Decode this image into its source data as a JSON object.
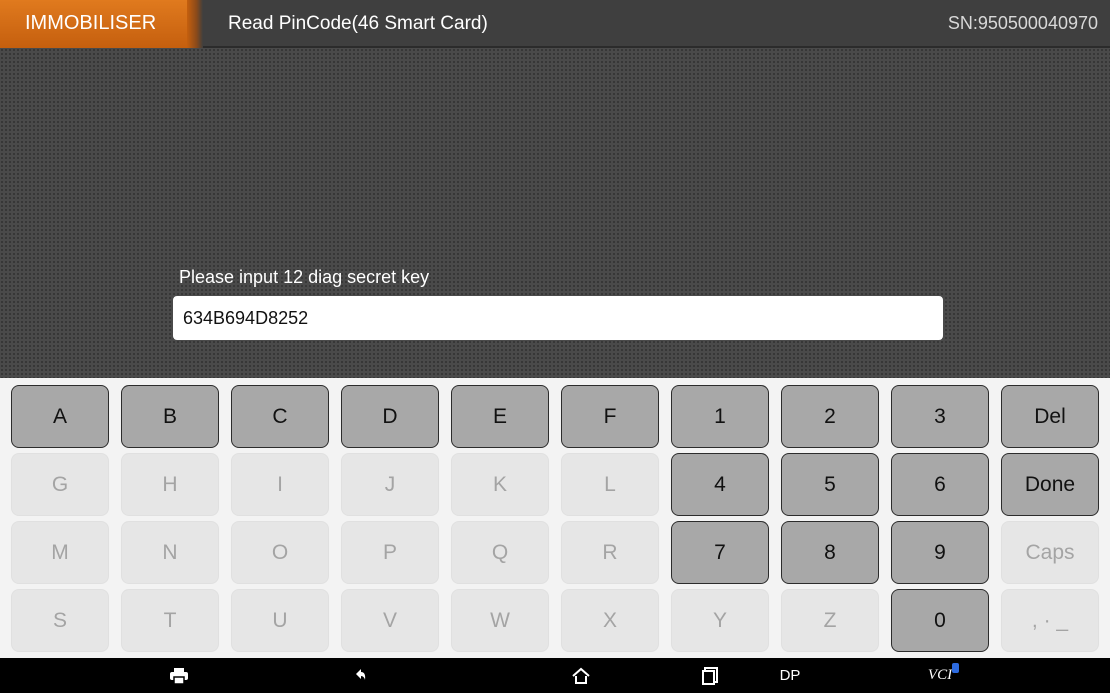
{
  "header": {
    "module": "IMMOBILISER",
    "title": "Read PinCode(46 Smart Card)",
    "serial": "SN:950500040970"
  },
  "form": {
    "prompt": "Please input 12 diag secret key",
    "value": "634B694D8252"
  },
  "keyboard": {
    "row1": [
      "A",
      "B",
      "C",
      "D",
      "E",
      "F",
      "1",
      "2",
      "3",
      "Del"
    ],
    "row2": [
      "G",
      "H",
      "I",
      "J",
      "K",
      "L",
      "4",
      "5",
      "6",
      "Done"
    ],
    "row3": [
      "M",
      "N",
      "O",
      "P",
      "Q",
      "R",
      "7",
      "8",
      "9",
      "Caps"
    ],
    "row4": [
      "S",
      "T",
      "U",
      "V",
      "W",
      "X",
      "Y",
      "Z",
      "0",
      ", · _"
    ]
  },
  "navbar": {
    "dp_label": "DP",
    "vci_label": "VCI"
  },
  "colors": {
    "accent": "#d86d17",
    "active_key": "#a8a8a8",
    "inactive_key": "#e6e6e6"
  },
  "icons": [
    "screenshot-icon",
    "back-icon",
    "home-icon",
    "recent-apps-icon",
    "bluetooth-icon"
  ]
}
